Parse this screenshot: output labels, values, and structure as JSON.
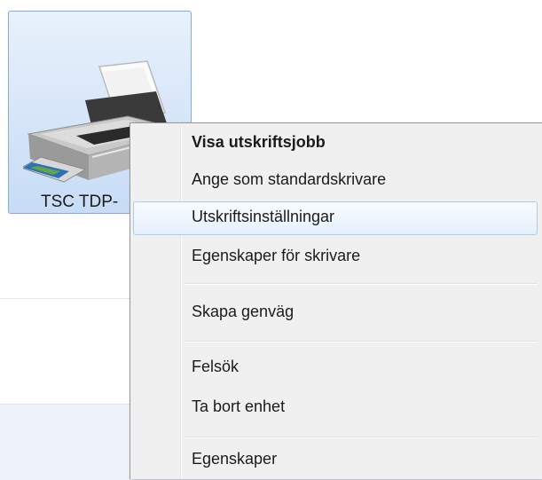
{
  "device": {
    "label": "TSC TDP-",
    "icon": "printer-icon"
  },
  "context_menu": {
    "items": [
      {
        "label": "Visa utskriftsjobb",
        "bold": true
      },
      {
        "label": "Ange som standardskrivare"
      },
      {
        "label": "Utskriftsinställningar",
        "highlighted": true
      },
      {
        "label": "Egenskaper för skrivare"
      },
      {
        "label": "Skapa genväg"
      },
      {
        "label": "Felsök"
      },
      {
        "label": "Ta bort enhet"
      },
      {
        "label": "Egenskaper"
      }
    ]
  },
  "colors": {
    "selection_border": "#84acdd",
    "menu_background": "#f0f0f0",
    "hover_border": "#a8cdf0"
  }
}
